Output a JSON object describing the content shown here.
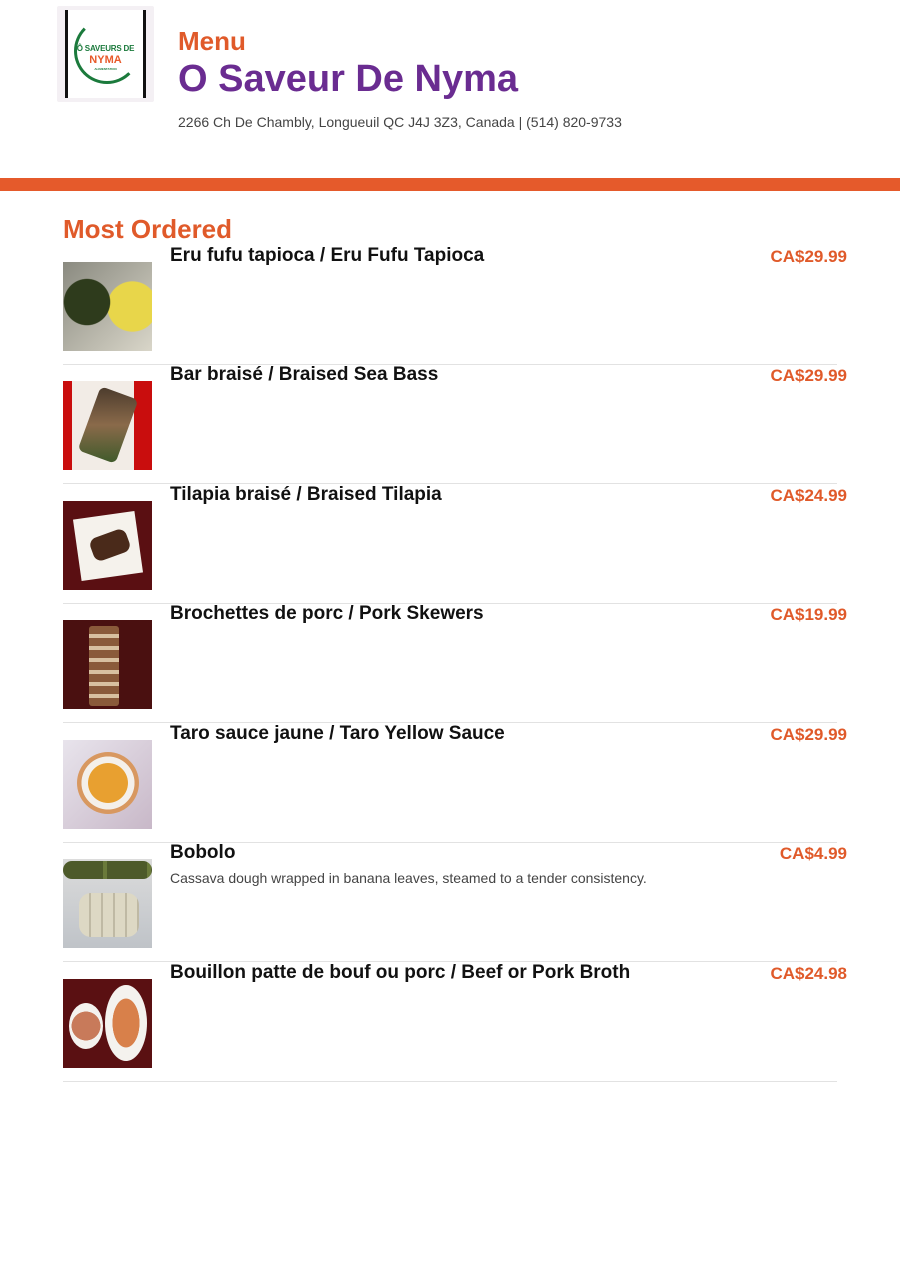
{
  "header": {
    "logo": {
      "line1": "Ô SAVEURS DE",
      "line2": "NYMA",
      "line3": "ALIMENTATION"
    },
    "menu_label": "Menu",
    "restaurant_name": "O Saveur De Nyma",
    "address": "2266 Ch De Chambly, Longueuil QC J4J 3Z3, Canada | (514) 820-9733"
  },
  "colors": {
    "accent": "#e05a2a",
    "brand": "#6a2c91",
    "bar": "#e55a2b"
  },
  "section": {
    "title": "Most Ordered",
    "items": [
      {
        "name": "Eru fufu tapioca / Eru Fufu Tapioca",
        "description": "",
        "price": "CA$29.99"
      },
      {
        "name": "Bar braisé / Braised Sea Bass",
        "description": "",
        "price": "CA$29.99"
      },
      {
        "name": "Tilapia braisé / Braised Tilapia",
        "description": "",
        "price": "CA$24.99"
      },
      {
        "name": "Brochettes de porc / Pork Skewers",
        "description": "",
        "price": "CA$19.99"
      },
      {
        "name": "Taro sauce jaune / Taro Yellow Sauce",
        "description": "",
        "price": "CA$29.99"
      },
      {
        "name": "Bobolo",
        "description": "Cassava dough wrapped in banana leaves, steamed to a tender consistency.",
        "price": "CA$4.99"
      },
      {
        "name": "Bouillon patte de bouf ou porc / Beef or Pork Broth",
        "description": "",
        "price": "CA$24.98"
      }
    ]
  }
}
